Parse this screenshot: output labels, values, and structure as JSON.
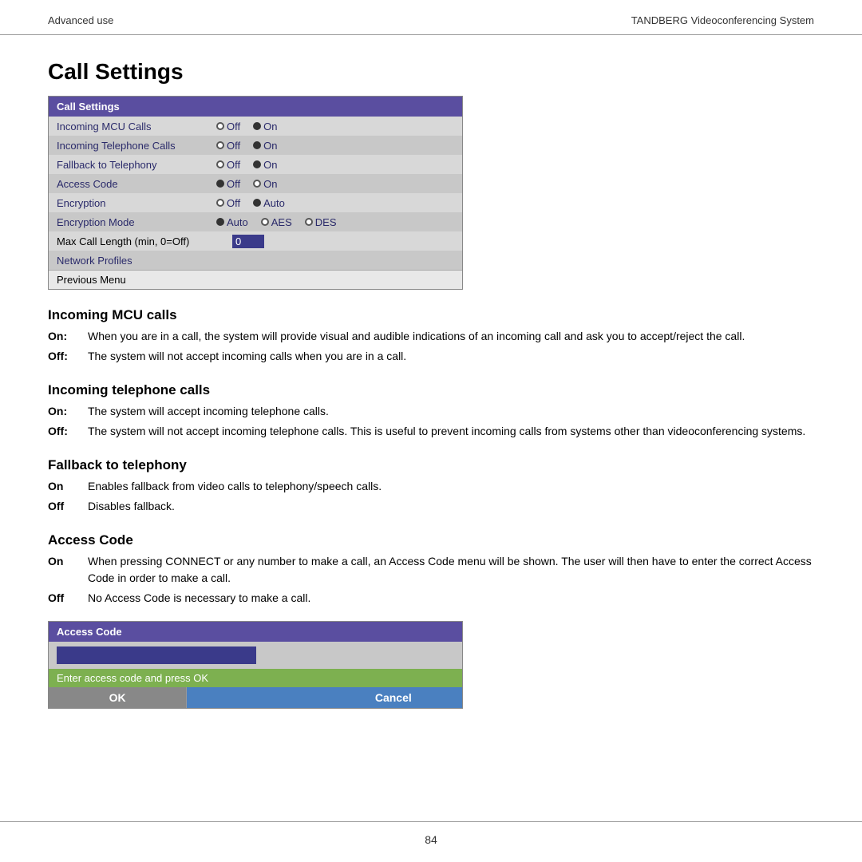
{
  "header": {
    "left": "Advanced use",
    "right": "TANDBERG Videoconferencing System"
  },
  "page_title": "Call Settings",
  "settings_table": {
    "title": "Call Settings",
    "rows": [
      {
        "label": "Incoming MCU Calls",
        "options": [
          {
            "label": "Off",
            "selected": false
          },
          {
            "label": "On",
            "selected": true
          }
        ]
      },
      {
        "label": "Incoming Telephone Calls",
        "options": [
          {
            "label": "Off",
            "selected": false
          },
          {
            "label": "On",
            "selected": true
          }
        ]
      },
      {
        "label": "Fallback to Telephony",
        "options": [
          {
            "label": "Off",
            "selected": false
          },
          {
            "label": "On",
            "selected": true
          }
        ]
      },
      {
        "label": "Access Code",
        "options": [
          {
            "label": "Off",
            "selected": true
          },
          {
            "label": "On",
            "selected": false
          }
        ]
      },
      {
        "label": "Encryption",
        "options": [
          {
            "label": "Off",
            "selected": false
          },
          {
            "label": "Auto",
            "selected": true
          }
        ]
      },
      {
        "label": "Encryption Mode",
        "options": [
          {
            "label": "Auto",
            "selected": true
          },
          {
            "label": "AES",
            "selected": false
          },
          {
            "label": "DES",
            "selected": false
          }
        ]
      },
      {
        "label": "Max Call Length (min, 0=Off)",
        "input_value": "0",
        "is_input": true
      },
      {
        "label": "Network Profiles",
        "is_network": true
      }
    ],
    "prev_menu_label": "Previous Menu"
  },
  "sections": [
    {
      "title": "Incoming MCU calls",
      "items": [
        {
          "term": "On:",
          "definition": "When you are in a call, the system will provide visual and audible indications of an incoming call and ask you to accept/reject the call."
        },
        {
          "term": "Off:",
          "definition": "The system will not accept incoming calls when you are in a call."
        }
      ]
    },
    {
      "title": "Incoming telephone calls",
      "items": [
        {
          "term": "On:",
          "definition": "The system will accept incoming telephone calls."
        },
        {
          "term": "Off:",
          "definition": "The system will not accept incoming telephone calls. This is useful to prevent incoming calls from systems other than videoconferencing systems."
        }
      ]
    },
    {
      "title": "Fallback to telephony",
      "items": [
        {
          "term": "On",
          "definition": "Enables fallback from video calls to telephony/speech calls."
        },
        {
          "term": "Off",
          "definition": "Disables fallback."
        }
      ]
    },
    {
      "title": "Access Code",
      "items": [
        {
          "term": "On",
          "definition": "When pressing CONNECT or any number to make a call, an Access Code menu will be shown. The user will then have to enter the correct Access Code in order to make a call."
        },
        {
          "term": "Off",
          "definition": "No Access Code is necessary to make a call."
        }
      ]
    }
  ],
  "access_code_dialog": {
    "title": "Access Code",
    "input_placeholder": "",
    "hint": "Enter access code and press OK",
    "ok_label": "OK",
    "cancel_label": "Cancel"
  },
  "footer": {
    "page_number": "84"
  }
}
